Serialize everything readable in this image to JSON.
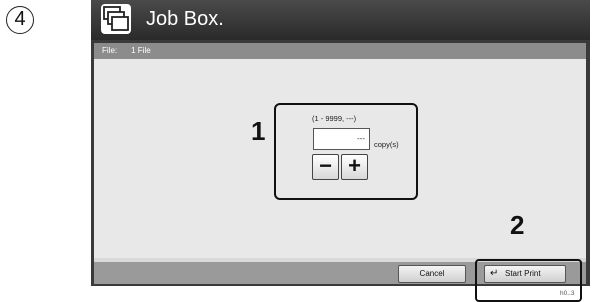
{
  "step_number": "4",
  "window": {
    "title": "Job Box."
  },
  "file_bar": {
    "label": "File:",
    "value": "1 File"
  },
  "copies": {
    "range": "(1 - 9999, ---)",
    "value": "---",
    "unit": "copy(s)",
    "minus": "−",
    "plus": "+"
  },
  "callouts": {
    "one": "1",
    "two": "2"
  },
  "buttons": {
    "cancel": "Cancel",
    "start_print": "Start Print"
  },
  "image_code": "h0..3"
}
